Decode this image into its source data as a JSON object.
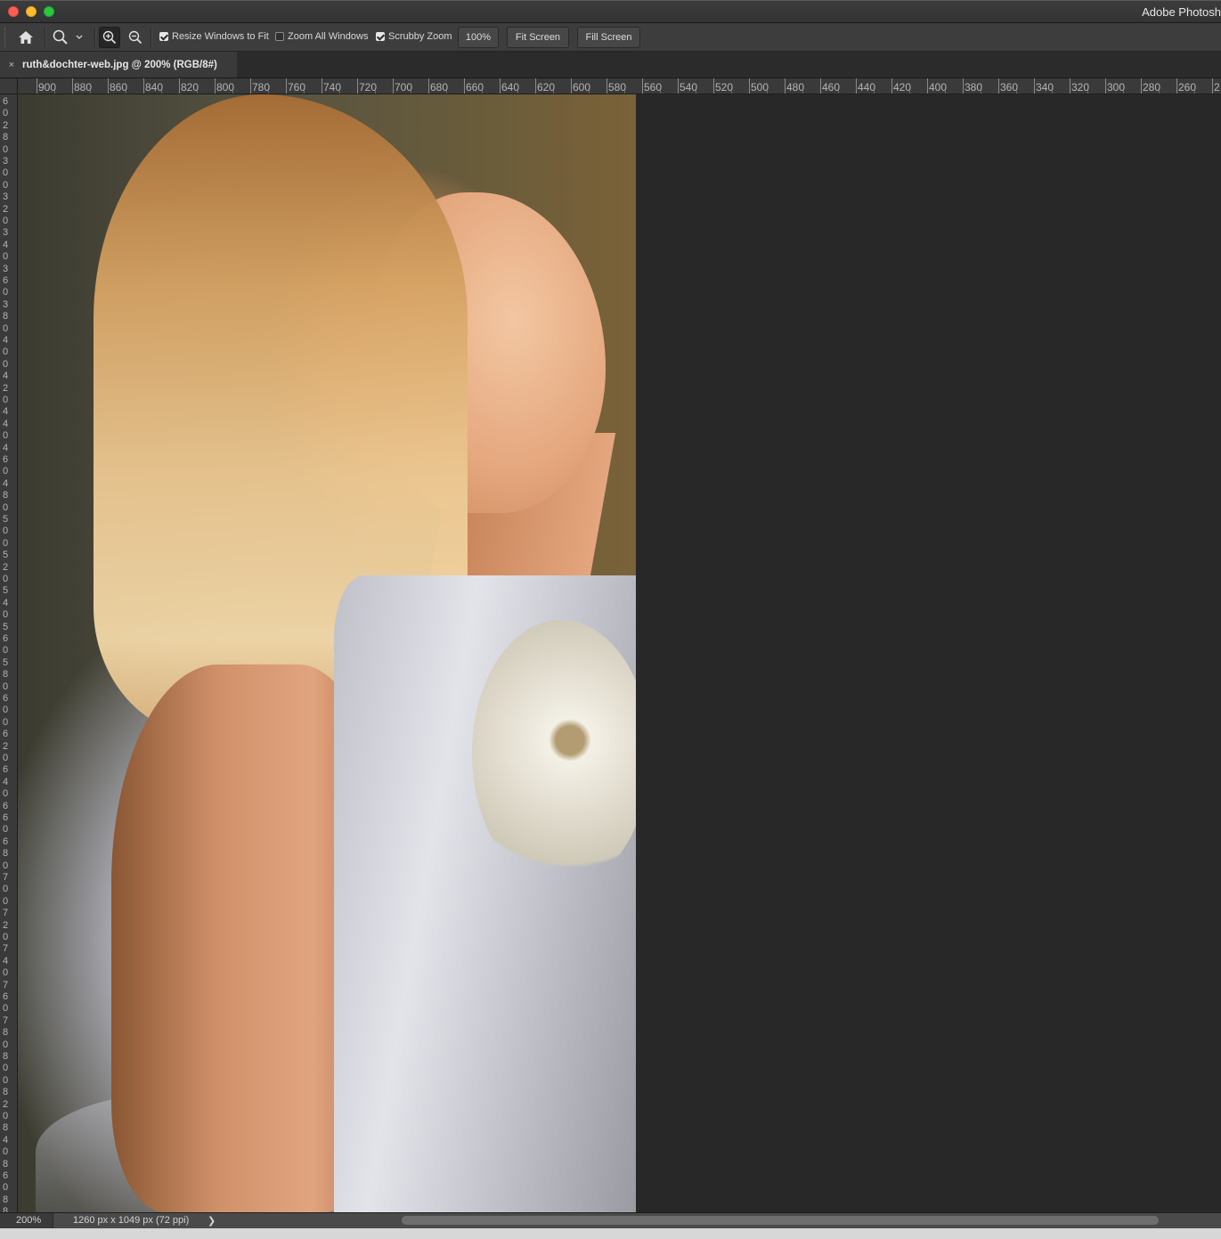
{
  "window": {
    "app_title": "Adobe Photosh",
    "traffic_lights": [
      "close",
      "minimize",
      "maximize"
    ]
  },
  "options_bar": {
    "home_icon": "home-icon",
    "tool_icon": "zoom-tool-icon",
    "zoom_in_icon": "zoom-in-icon",
    "zoom_out_icon": "zoom-out-icon",
    "resize_windows_to_fit": {
      "label": "Resize Windows to Fit",
      "checked": true
    },
    "zoom_all_windows": {
      "label": "Zoom All Windows",
      "checked": false
    },
    "scrubby_zoom": {
      "label": "Scrubby Zoom",
      "checked": true
    },
    "zoom_100_label": "100%",
    "fit_screen_label": "Fit Screen",
    "fill_screen_label": "Fill Screen"
  },
  "document": {
    "tab_title": "ruth&dochter-web.jpg @ 200% (RGB/8#)",
    "close_glyph": "×"
  },
  "rulers": {
    "horizontal_labels": [
      "900",
      "880",
      "860",
      "840",
      "820",
      "800",
      "780",
      "760",
      "740",
      "720",
      "700",
      "680",
      "660",
      "640",
      "620",
      "600",
      "580",
      "560",
      "540",
      "520",
      "500",
      "480",
      "460",
      "440",
      "420",
      "400",
      "380",
      "360",
      "340",
      "320",
      "300",
      "280",
      "260",
      "2"
    ],
    "vertical_labels": [
      "6",
      "0",
      "2",
      "8",
      "0",
      "3",
      "0",
      "0",
      "3",
      "2",
      "0",
      "3",
      "4",
      "0",
      "3",
      "6",
      "0",
      "3",
      "8",
      "0",
      "4",
      "0",
      "0",
      "4",
      "2",
      "0",
      "4",
      "4",
      "0",
      "4",
      "6",
      "0",
      "4",
      "8",
      "0",
      "5",
      "0",
      "0",
      "5",
      "2",
      "0",
      "5",
      "4",
      "0",
      "5",
      "6",
      "0",
      "5",
      "8",
      "0",
      "6",
      "0",
      "0",
      "6",
      "2",
      "0",
      "6",
      "4",
      "0",
      "6",
      "6",
      "0",
      "6",
      "8",
      "0",
      "7",
      "0",
      "0",
      "7",
      "2",
      "0",
      "7",
      "4",
      "0",
      "7",
      "6",
      "0",
      "7",
      "8",
      "0",
      "8",
      "0",
      "0",
      "8",
      "2",
      "0",
      "8",
      "4",
      "0",
      "8",
      "6",
      "0",
      "8",
      "8",
      "8"
    ]
  },
  "status_bar": {
    "zoom": "200%",
    "doc_info": "1260 px x 1049 px (72 ppi)",
    "arrow": "❯"
  }
}
